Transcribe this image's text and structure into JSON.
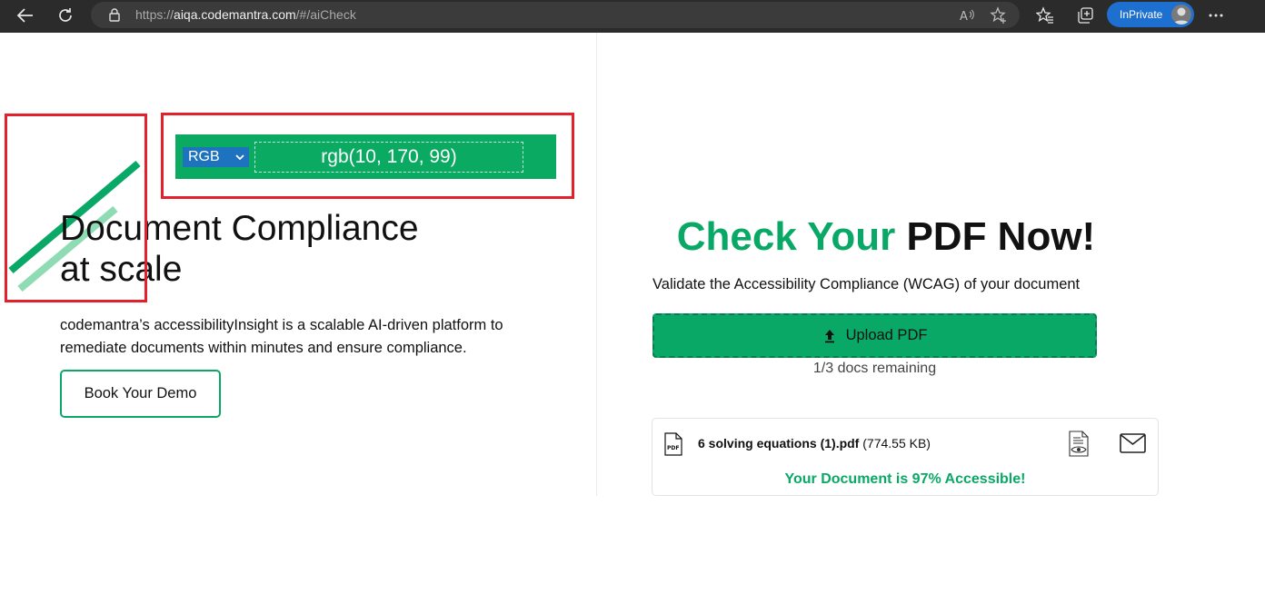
{
  "browser": {
    "url_prefix": "https://",
    "url_host": "aiqa.codemantra.com",
    "url_path": "/#/aiCheck",
    "inprivate_label": "InPrivate"
  },
  "color_picker": {
    "mode": "RGB",
    "value": "rgb(10, 170, 99)",
    "swatch_color": "#0aaa63"
  },
  "hero": {
    "title_line1": "Document Compliance",
    "title_line2": "at scale",
    "description": "codemantra’s accessibilityInsight is a scalable AI-driven platform to remediate documents within minutes and ensure compliance.",
    "demo_button": "Book Your Demo"
  },
  "checker": {
    "title_green": "Check Your",
    "title_dark": "PDF Now!",
    "subtitle": "Validate the Accessibility Compliance (WCAG) of your document",
    "upload_button": "Upload PDF",
    "remaining": "1/3 docs remaining"
  },
  "result_card": {
    "file_name": "6 solving equations (1).pdf",
    "file_size": "(774.55 KB)",
    "result_text": "Your Document is 97% Accessible!",
    "pdf_icon_label": "PDF"
  },
  "colors": {
    "brand_green": "#0aa866",
    "highlight_red": "#e4202c",
    "select_blue": "#1e73be"
  }
}
